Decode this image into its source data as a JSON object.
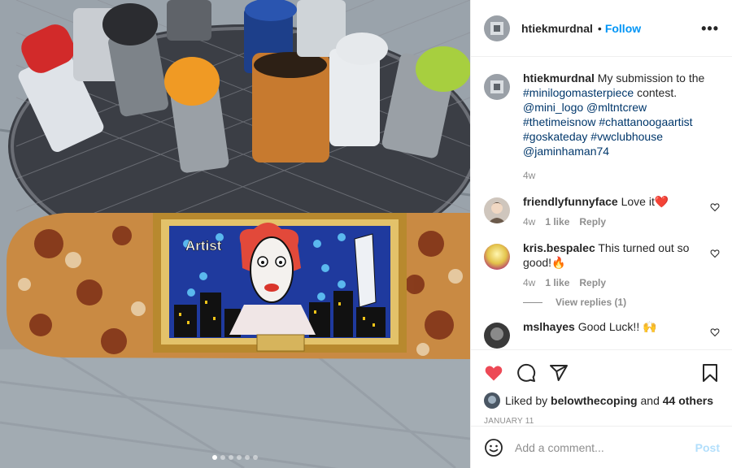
{
  "post": {
    "author": "htiekmurdnal",
    "follow_label": "Follow",
    "more_label": "•••",
    "caption": {
      "author": "htiekmurdnal",
      "text_plain": "My submission to the",
      "tags_line1": "#minilogomasterpiece",
      "text_after": "contest.",
      "tags_rest": "@mini_logo @mltntcrew #thetimeisnow #chattanoogaartist #goskateday #vwclubhouse @jaminhaman74",
      "age": "4w"
    },
    "comments": [
      {
        "author": "friendlyfunnyface",
        "text": "Love it❤️",
        "age": "4w",
        "likes": "1 like",
        "reply_label": "Reply"
      },
      {
        "author": "kris.bespalec",
        "text": "This turned out so good!🔥",
        "age": "4w",
        "likes": "1 like",
        "reply_label": "Reply",
        "view_replies": "View replies (1)"
      },
      {
        "author": "mslhayes",
        "text": "Good Luck!! 🙌"
      }
    ],
    "liked_by_prefix": "Liked by",
    "liked_by_user": "belowthecoping",
    "liked_by_and": "and",
    "liked_by_others": "44 others",
    "date": "January 11",
    "add_comment_placeholder": "Add a comment...",
    "post_button": "Post",
    "carousel": {
      "count": 6,
      "active_index": 0
    }
  },
  "colors": {
    "like_active": "#ed4956",
    "link": "#00376b",
    "follow": "#0095f6"
  },
  "icons": [
    "heart-filled-icon",
    "comment-icon",
    "share-icon",
    "bookmark-icon",
    "emoji-icon",
    "more-icon"
  ],
  "image": {
    "board_text_artist": "Artist"
  }
}
